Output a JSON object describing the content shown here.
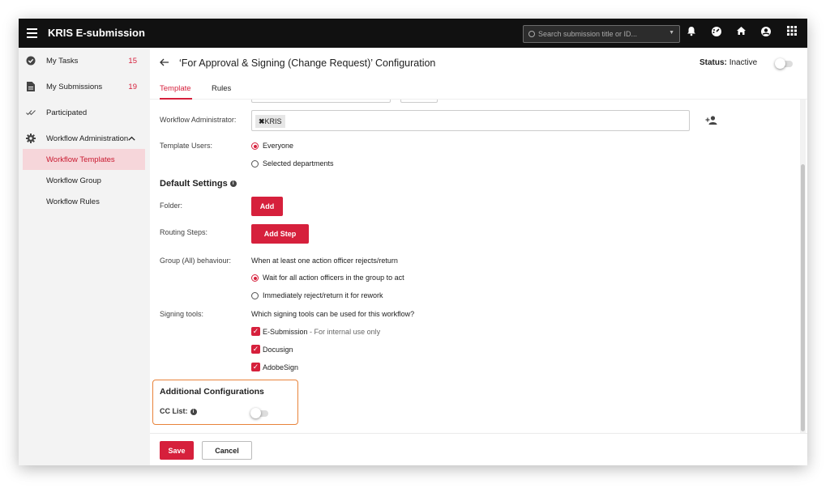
{
  "app": {
    "title": "KRIS E-submission"
  },
  "search": {
    "placeholder": "Search submission title or ID..."
  },
  "topbar_icons": [
    "bell-icon",
    "dashboard-icon",
    "home-icon",
    "account-icon",
    "apps-grid-icon"
  ],
  "sidebar": {
    "items": [
      {
        "label": "My Tasks",
        "count": "15",
        "icon": "check-circle-icon"
      },
      {
        "label": "My Submissions",
        "count": "19",
        "icon": "document-icon"
      },
      {
        "label": "Participated",
        "count": "",
        "icon": "double-check-icon"
      },
      {
        "label": "Workflow Administration",
        "count": "",
        "icon": "gear-icon"
      }
    ],
    "sub_items": [
      {
        "label": "Workflow Templates",
        "active": true
      },
      {
        "label": "Workflow Group",
        "active": false
      },
      {
        "label": "Workflow Rules",
        "active": false
      }
    ]
  },
  "header": {
    "title": "‘For Approval & Signing (Change Request)’ Configuration",
    "status_label": "Status:",
    "status_value": "Inactive"
  },
  "tabs": [
    {
      "label": "Template",
      "active": true
    },
    {
      "label": "Rules",
      "active": false
    }
  ],
  "form": {
    "workflow_admin_label": "Workflow Administrator:",
    "workflow_admin_chip": "KRIS",
    "template_users_label": "Template Users:",
    "template_users_options": [
      "Everyone",
      "Selected departments"
    ],
    "default_settings_title": "Default Settings",
    "folder_label": "Folder:",
    "folder_button": "Add",
    "routing_label": "Routing Steps:",
    "routing_button": "Add Step",
    "group_label": "Group (All) behaviour:",
    "group_question": "When at least one action officer rejects/return",
    "group_options": [
      "Wait for all action officers in the group to act",
      "Immediately reject/return it for rework"
    ],
    "signing_label": "Signing tools:",
    "signing_question": "Which signing tools can be used for this workflow?",
    "signing_tools": [
      {
        "name": "E-Submission",
        "note": "- For internal use only"
      },
      {
        "name": "Docusign",
        "note": ""
      },
      {
        "name": "AdobeSign",
        "note": ""
      }
    ],
    "additional_title": "Additional Configurations",
    "cc_label": "CC List:"
  },
  "footer": {
    "save": "Save",
    "cancel": "Cancel"
  },
  "colors": {
    "accent": "#d6203c",
    "highlight_border": "#e8833a",
    "topbar": "#111111"
  }
}
